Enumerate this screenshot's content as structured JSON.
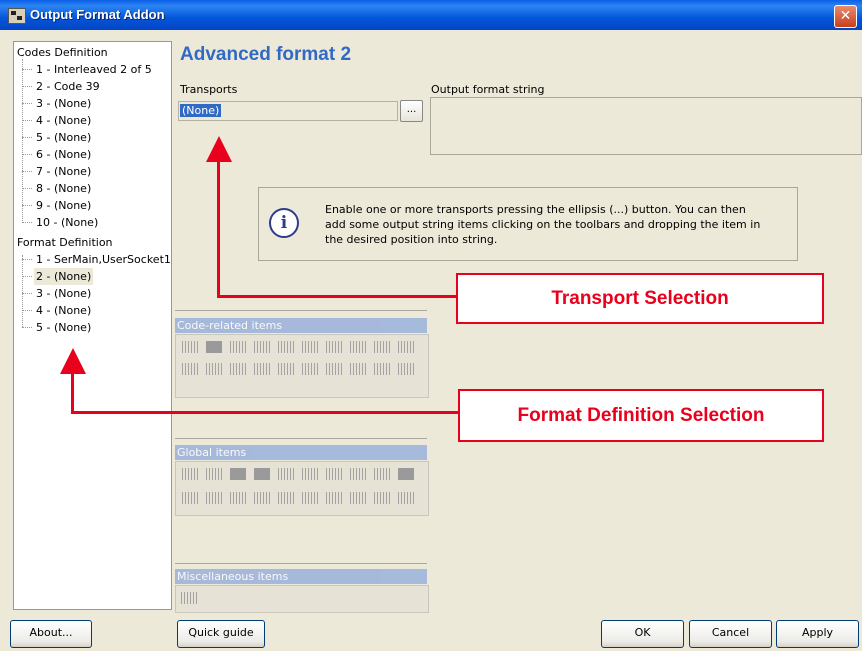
{
  "window": {
    "title": "Output Format Addon",
    "close_icon": "close-icon"
  },
  "tree": {
    "codes_group": "Codes Definition",
    "codes": [
      "1 - Interleaved 2 of 5",
      "2 - Code 39",
      "3 - (None)",
      "4 - (None)",
      "5 - (None)",
      "6 - (None)",
      "7 - (None)",
      "8 - (None)",
      "9 - (None)",
      "10 - (None)"
    ],
    "format_group": "Format Definition",
    "formats": [
      "1 - SerMain,UserSocket1",
      "2 - (None)",
      "3 - (None)",
      "4 - (None)",
      "5 - (None)"
    ],
    "selected": "2 - (None)"
  },
  "main": {
    "title": "Advanced format 2",
    "transports_label": "Transports",
    "transports_value": "(None)",
    "ellipsis_label": "...",
    "output_label": "Output format string",
    "info_text": "Enable one or more transports pressing the ellipsis (...) button. You can then add some output string items clicking on the toolbars and dropping the item in the desired position into string.",
    "info_icon": "info-icon"
  },
  "panels": {
    "code_items": "Code-related items",
    "global_items": "Global items",
    "misc_items": "Miscellaneous items"
  },
  "callouts": {
    "transport": "Transport Selection",
    "format": "Format Definition Selection",
    "color": "#E8001C"
  },
  "buttons": {
    "about": "About...",
    "quick_guide": "Quick guide",
    "ok": "OK",
    "cancel": "Cancel",
    "apply": "Apply"
  }
}
